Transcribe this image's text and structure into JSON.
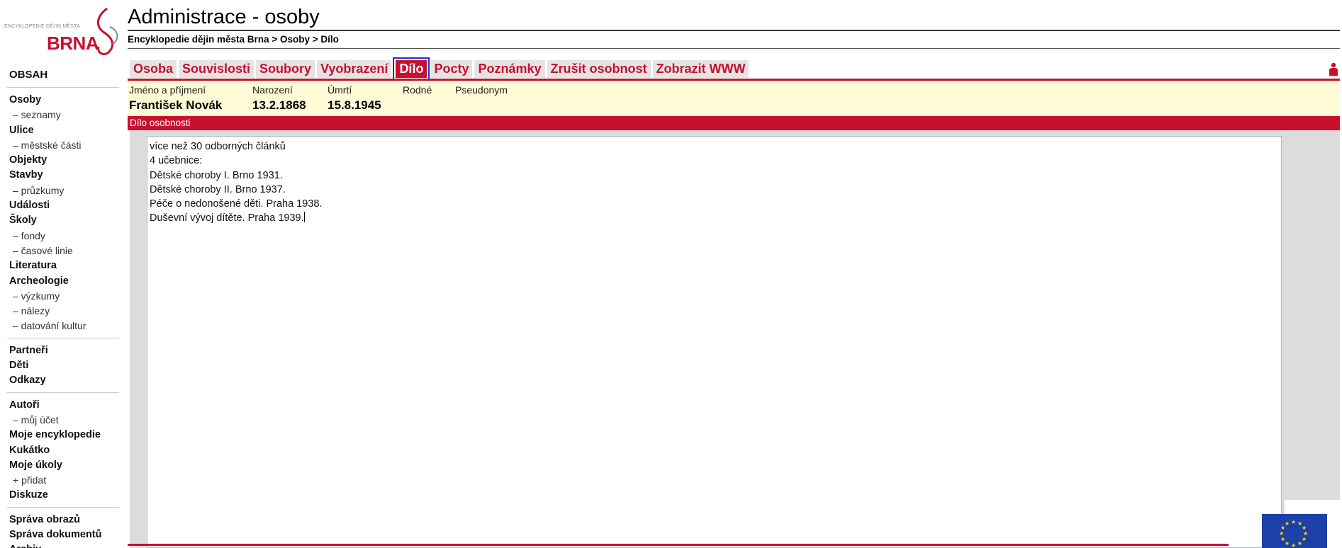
{
  "logo": {
    "small_text": "ENCYKLOPEDIE DĚJIN MĚSTA",
    "big_text": "BRNA"
  },
  "sidebar": {
    "header": "OBSAH",
    "groups": [
      [
        {
          "label": "Osoby",
          "kind": "item"
        },
        {
          "label": "– seznamy",
          "kind": "sub"
        },
        {
          "label": "Ulice",
          "kind": "item"
        },
        {
          "label": "– městské části",
          "kind": "sub"
        },
        {
          "label": "Objekty",
          "kind": "item"
        },
        {
          "label": "Stavby",
          "kind": "item"
        },
        {
          "label": "– průzkumy",
          "kind": "sub"
        },
        {
          "label": "Události",
          "kind": "item"
        },
        {
          "label": "Školy",
          "kind": "item"
        },
        {
          "label": "– fondy",
          "kind": "sub"
        },
        {
          "label": "– časové linie",
          "kind": "sub"
        },
        {
          "label": "Literatura",
          "kind": "item"
        },
        {
          "label": "Archeologie",
          "kind": "item"
        },
        {
          "label": "– výzkumy",
          "kind": "sub"
        },
        {
          "label": "– nálezy",
          "kind": "sub"
        },
        {
          "label": "– datování kultur",
          "kind": "sub"
        }
      ],
      [
        {
          "label": "Partneři",
          "kind": "item"
        },
        {
          "label": "Děti",
          "kind": "item"
        },
        {
          "label": "Odkazy",
          "kind": "item"
        }
      ],
      [
        {
          "label": "Autoři",
          "kind": "item"
        },
        {
          "label": "– můj účet",
          "kind": "sub"
        },
        {
          "label": "Moje encyklopedie",
          "kind": "item"
        },
        {
          "label": "Kukátko",
          "kind": "item"
        },
        {
          "label": "Moje úkoly",
          "kind": "item"
        },
        {
          "label": "+ přidat",
          "kind": "sub"
        },
        {
          "label": "Diskuze",
          "kind": "item"
        }
      ],
      [
        {
          "label": "Správa obrazů",
          "kind": "item"
        },
        {
          "label": "Správa dokumentů",
          "kind": "item"
        },
        {
          "label": "Archiv",
          "kind": "item"
        }
      ]
    ]
  },
  "header": {
    "title": "Administrace - osoby",
    "breadcrumb": "Encyklopedie dějin města Brna > Osoby > Dílo"
  },
  "tabs": [
    {
      "label": "Osoba",
      "active": false
    },
    {
      "label": "Souvislosti",
      "active": false
    },
    {
      "label": "Soubory",
      "active": false
    },
    {
      "label": "Vyobrazení",
      "active": false
    },
    {
      "label": "Dílo",
      "active": true
    },
    {
      "label": "Pocty",
      "active": false
    },
    {
      "label": "Poznámky",
      "active": false
    },
    {
      "label": "Zrušit osobnost",
      "active": false
    },
    {
      "label": "Zobrazit WWW",
      "active": false
    }
  ],
  "person": {
    "name_label": "Jméno a příjmení",
    "name_value": "František Novák",
    "born_label": "Narození",
    "born_value": "13.2.1868",
    "died_label": "Úmrtí",
    "died_value": "15.8.1945",
    "rodne_label": "Rodné",
    "pseudonym_label": "Pseudonym"
  },
  "section": {
    "title": "Dílo osobnosti"
  },
  "editor": {
    "lines": [
      "více než 30 odborných článků",
      "4 učebnice:",
      "Dětské choroby I. Brno 1931.",
      "Dětské choroby II. Brno 1937.",
      "Péče o nedonošené děti. Praha 1938.",
      "Duševní vývoj dítěte. Praha 1939."
    ]
  },
  "colors": {
    "accent_red": "#c8102e",
    "info_bg": "#fffbd6",
    "tab_bg": "#e4e4e4",
    "focus_outline": "#1f2fd1"
  },
  "icons": {
    "person": "person-icon",
    "eu_flag": "eu-flag-icon"
  }
}
